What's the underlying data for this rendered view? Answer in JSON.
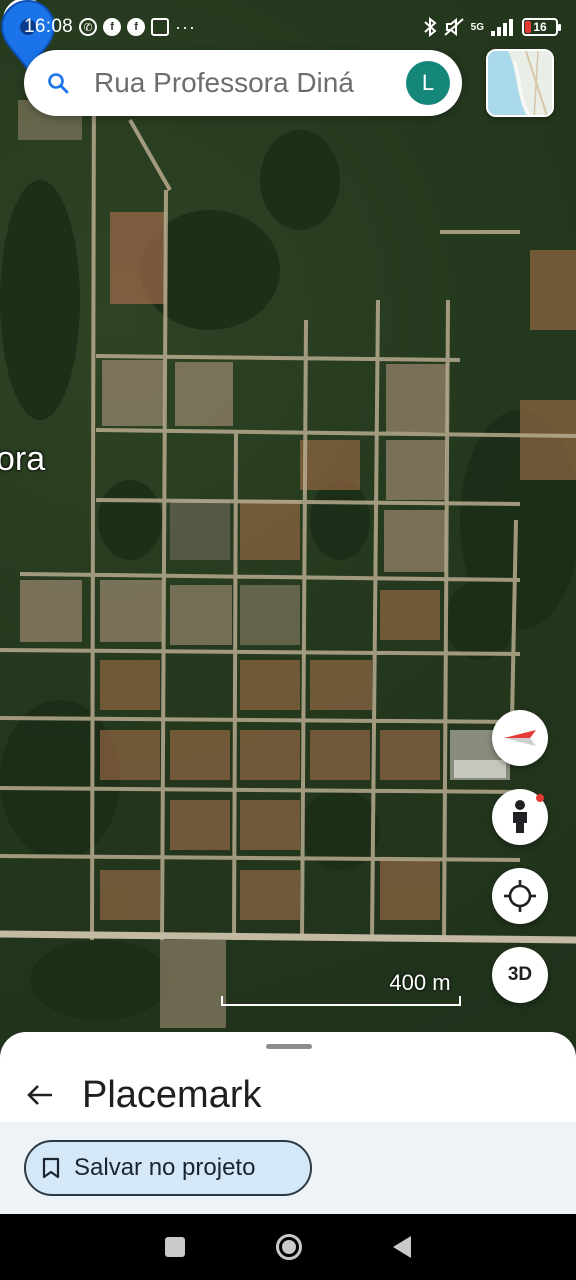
{
  "status_bar": {
    "time": "16:08",
    "network": "5G",
    "battery": "16",
    "icons": [
      "whatsapp-icon",
      "facebook-icon",
      "facebook-icon",
      "photo-icon",
      "more-dots-icon",
      "bluetooth-icon",
      "mute-icon",
      "signal-icon",
      "battery-icon"
    ]
  },
  "search": {
    "query": "Rua Professora Diná",
    "avatar_letter": "L"
  },
  "map": {
    "place_label": "ora",
    "scale_label": "400 m",
    "button_3d": "3D",
    "pin_color": "#1a73e8",
    "marker_color": "#6e8ea0"
  },
  "sheet": {
    "title": "Placemark",
    "save_label": "Salvar no projeto",
    "save_bg": "#d5e8f7"
  },
  "nav": {
    "buttons": [
      "recents-icon",
      "home-icon",
      "back-icon"
    ]
  }
}
